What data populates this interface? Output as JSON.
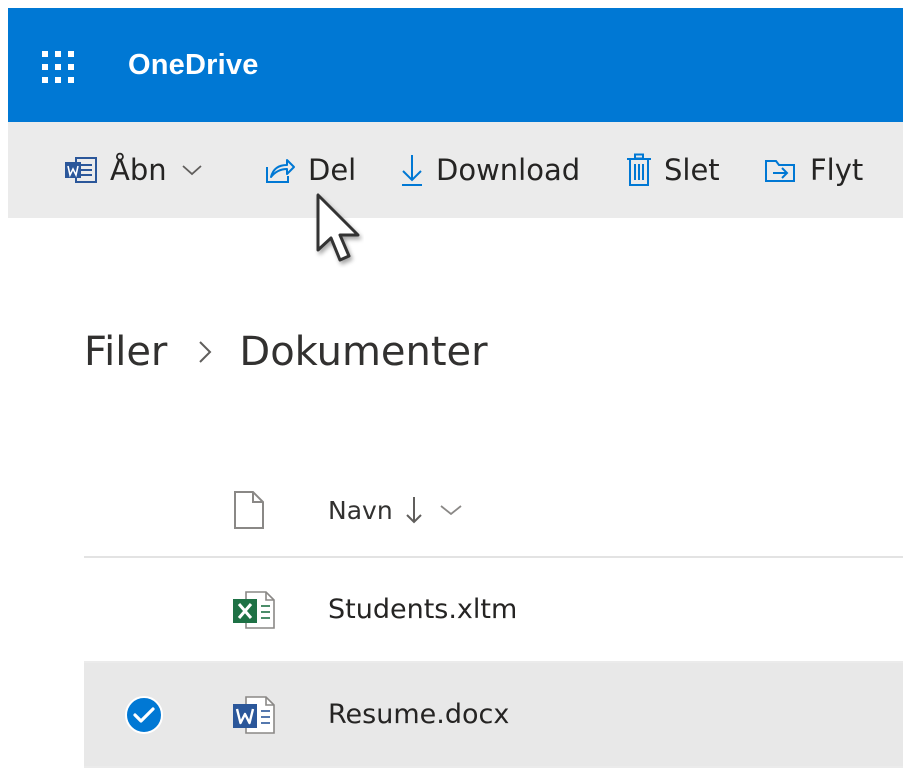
{
  "app": {
    "title": "OneDrive"
  },
  "toolbar": {
    "open_label": "Åbn",
    "share_label": "Del",
    "download_label": "Download",
    "delete_label": "Slet",
    "move_label": "Flyt"
  },
  "breadcrumb": {
    "root": "Filer",
    "current": "Dokumenter"
  },
  "list": {
    "column_name": "Navn",
    "sort_direction": "descending",
    "files": [
      {
        "name": "Students.xltm",
        "type": "excel",
        "selected": false
      },
      {
        "name": "Resume.docx",
        "type": "word",
        "selected": true
      }
    ]
  },
  "colors": {
    "brand": "#0078d4",
    "commandbar": "#ebebeb",
    "selected_row": "#e8e8e8",
    "excel": "#1e7145",
    "word": "#2b579a"
  }
}
